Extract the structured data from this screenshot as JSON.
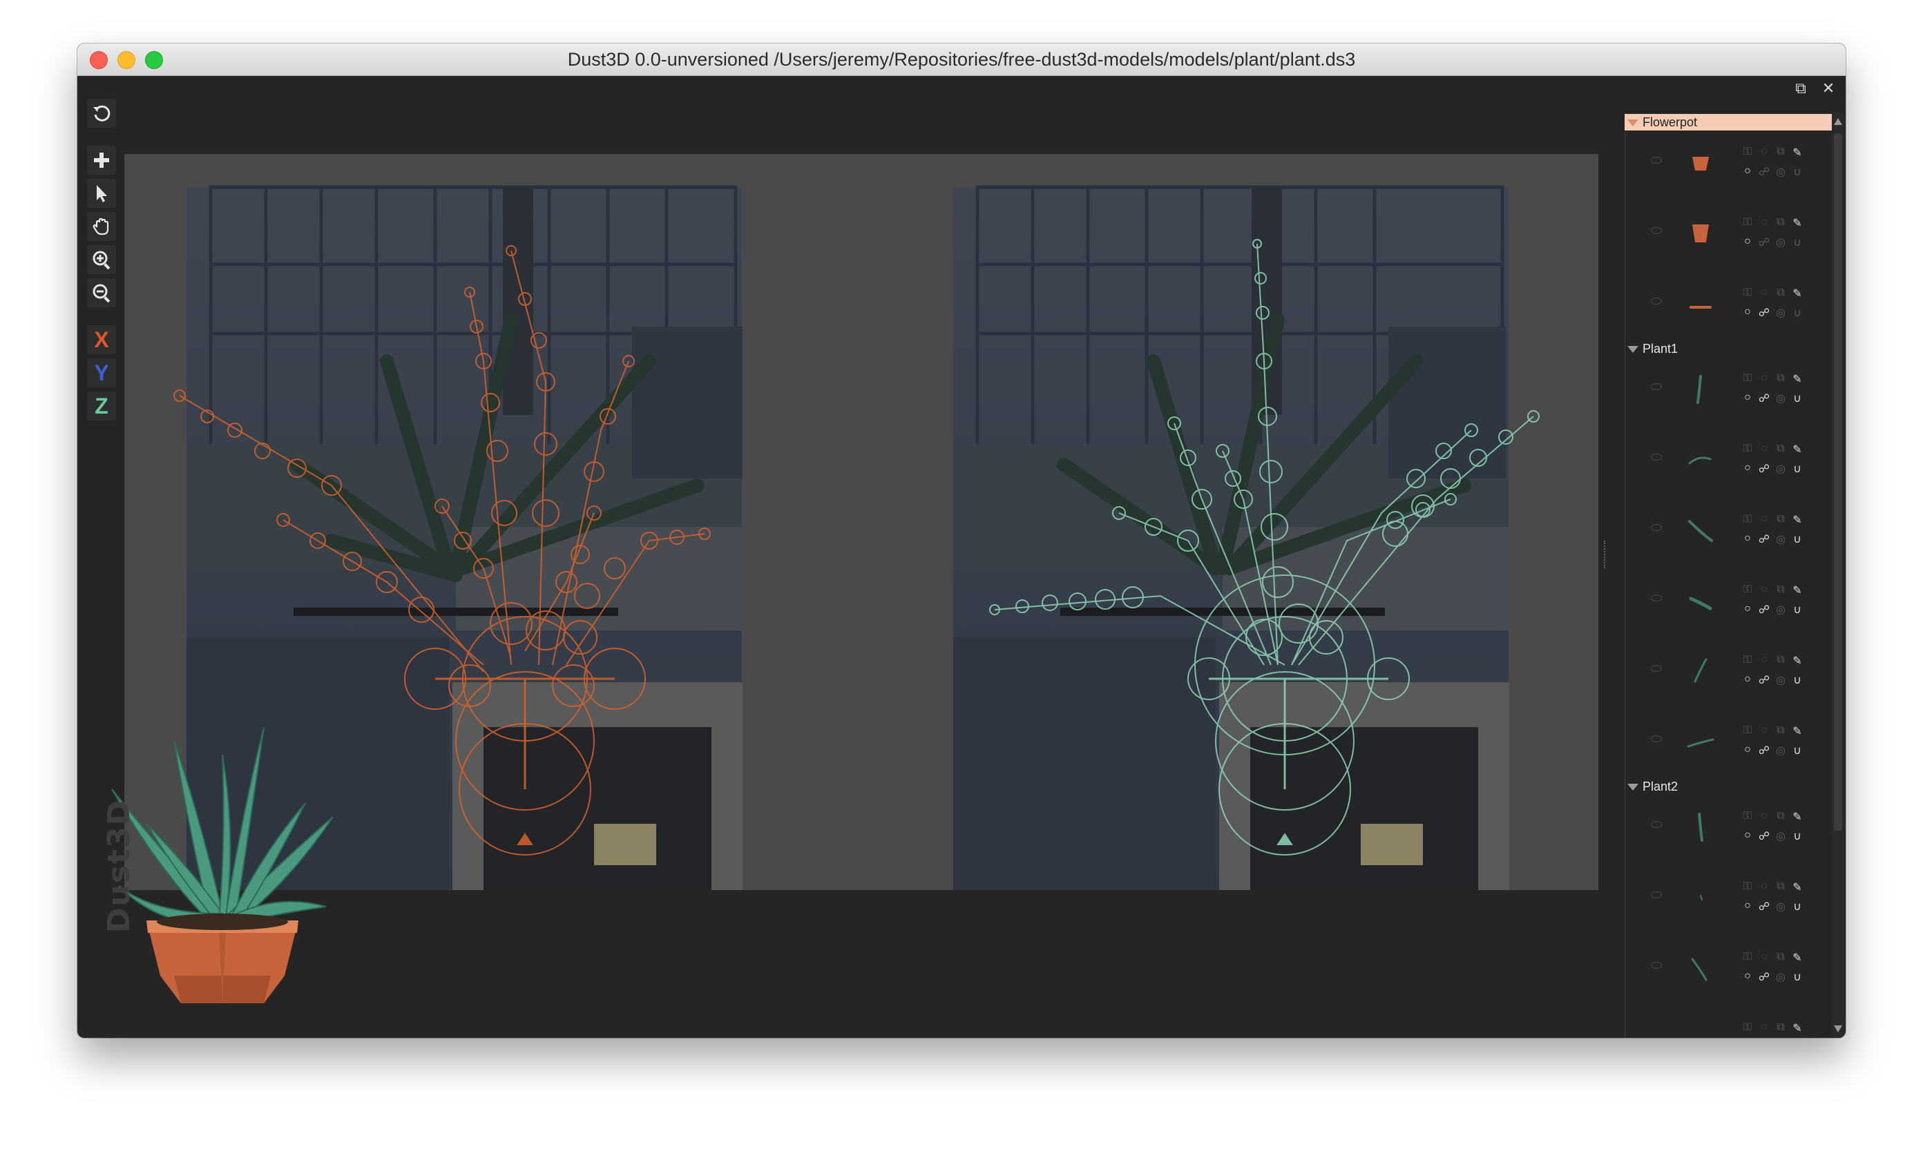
{
  "window": {
    "title": "Dust3D 0.0-unversioned /Users/jeremy/Repositories/free-dust3d-models/models/plant/plant.ds3"
  },
  "toolbar": {
    "tools": [
      "undo-icon",
      "add-icon",
      "select-arrow-icon",
      "hand-pan-icon",
      "zoom-in-icon",
      "zoom-out-icon"
    ],
    "axis_x": "X",
    "axis_y": "Y",
    "axis_z": "Z",
    "colors": {
      "x": "#e0562a",
      "y": "#3a60d8",
      "z": "#6cc8a0"
    }
  },
  "watermark": "Dust3D",
  "parts_panel": {
    "groups": [
      {
        "name": "Flowerpot",
        "selected": true,
        "parts": 3
      },
      {
        "name": "Plant1",
        "selected": false,
        "parts": 6
      },
      {
        "name": "Plant2",
        "selected": false,
        "parts": 4
      }
    ],
    "colors": {
      "flowerpot_thumb": "#c8643c",
      "plant_thumb": "#3e7a66",
      "selected_header": "#f6cdb4"
    }
  },
  "viewport": {
    "front_view_color": "#d9622a",
    "side_view_color": "#8fd6b8"
  }
}
